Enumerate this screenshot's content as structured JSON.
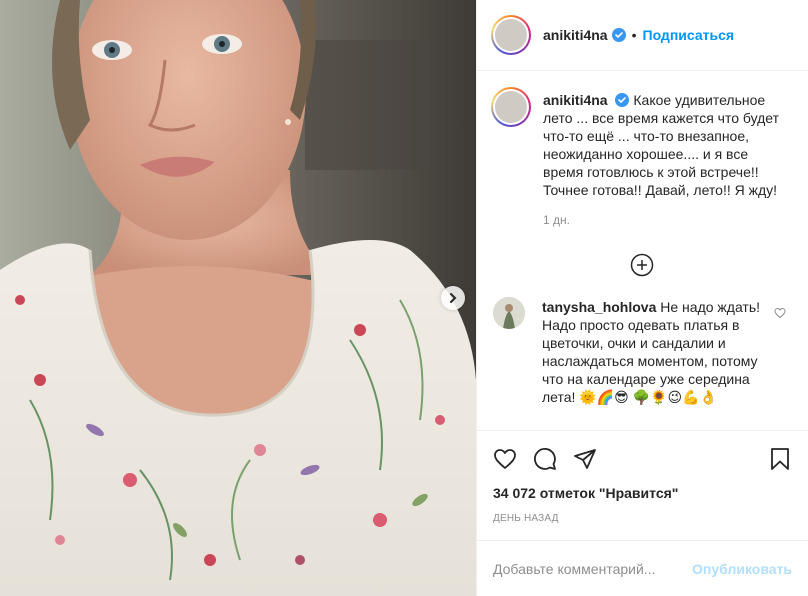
{
  "header": {
    "username": "anikiti4na",
    "verified_icon": "verified-badge-icon",
    "separator": "•",
    "follow_label": "Подписаться"
  },
  "caption": {
    "username": "anikiti4na",
    "text": "Какое удивительное лето ... все время кажется что будет что-то ещё ... что-то внезапное, неожиданно хорошее.... и я все время готовлюсь к этой встрече!! Точнее готова!! Давай, лето!! Я жду!",
    "time": "1 дн."
  },
  "more_comments_icon": "plus-circle-icon",
  "comment": {
    "username": "tanysha_hohlova",
    "text": "Не надо ждать! Надо просто одевать платья в цветочки, очки и сандалии и наслаждаться моментом, потому что на календаре уже середина лета!",
    "emoji": "🌞🌈😎 🌳🌻😉💪👌"
  },
  "actions": {
    "likes": "34 072 отметок \"Нравится\"",
    "date": "ДЕНЬ НАЗАД"
  },
  "add_comment": {
    "placeholder": "Добавьте комментарий...",
    "publish_label": "Опубликовать"
  },
  "colors": {
    "accent": "#0095f6",
    "muted": "#8e8e8e",
    "publish_disabled": "#b2dffc",
    "text": "#262626"
  }
}
